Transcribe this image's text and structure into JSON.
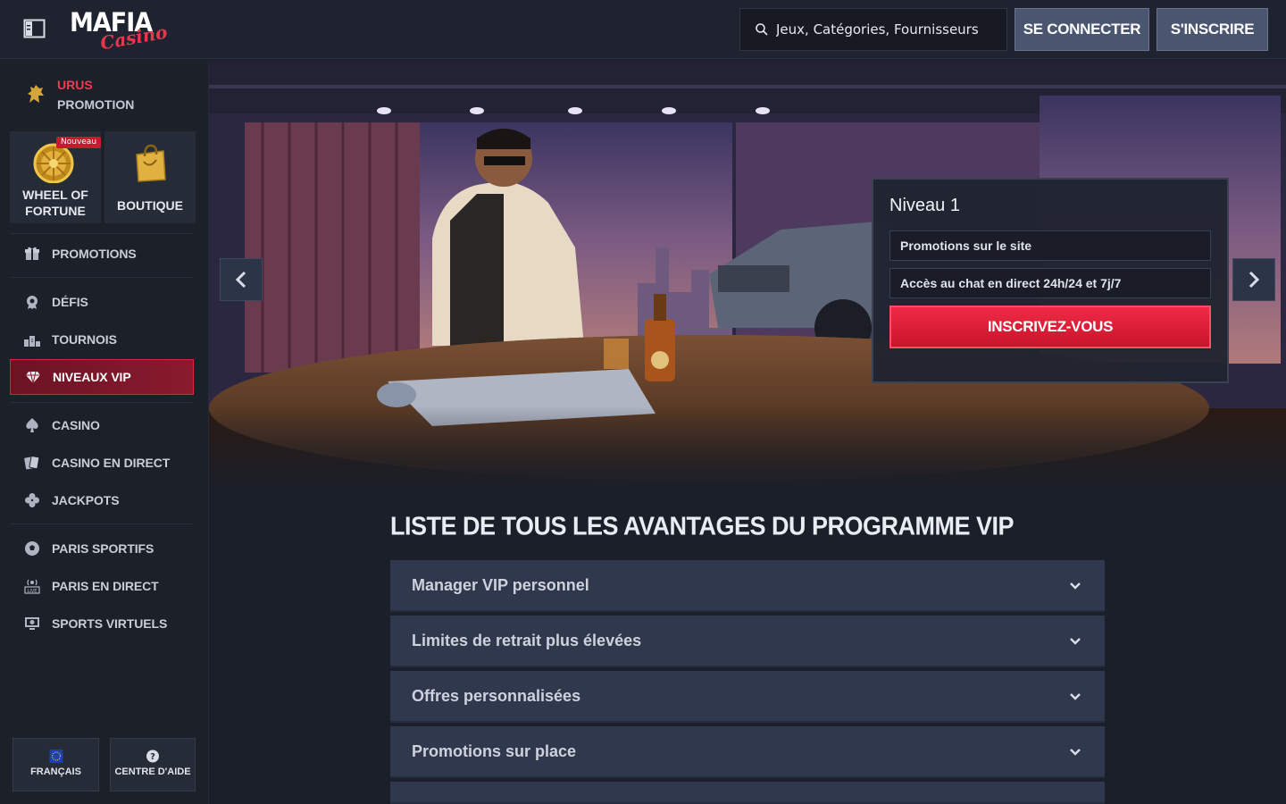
{
  "header": {
    "logo_main": "MAFIA",
    "logo_script": "Casino",
    "search_placeholder": "Jeux, Catégories, Fournisseurs",
    "login_label": "SE CONNECTER",
    "register_label": "S'INSCRIRE"
  },
  "sidebar": {
    "promo": {
      "line1": "URUS",
      "line2": "PROMOTION"
    },
    "tiles": [
      {
        "label_1": "WHEEL OF",
        "label_2": "FORTUNE",
        "badge": "Nouveau"
      },
      {
        "label": "BOUTIQUE"
      }
    ],
    "items": [
      {
        "label": "PROMOTIONS",
        "icon": "gift-icon"
      },
      {
        "label": "DÉFIS",
        "icon": "gear-badge-icon"
      },
      {
        "label": "TOURNOIS",
        "icon": "podium-icon"
      },
      {
        "label": "NIVEAUX VIP",
        "icon": "diamond-icon",
        "active": true
      },
      {
        "label": "CASINO",
        "icon": "spade-icon"
      },
      {
        "label": "CASINO EN DIRECT",
        "icon": "cards-icon"
      },
      {
        "label": "JACKPOTS",
        "icon": "clover-icon"
      },
      {
        "label": "PARIS SPORTIFS",
        "icon": "soccer-ball-icon"
      },
      {
        "label": "PARIS EN DIRECT",
        "icon": "live-icon"
      },
      {
        "label": "SPORTS VIRTUELS",
        "icon": "monitor-icon"
      }
    ],
    "bottom": {
      "language": "FRANÇAIS",
      "help": "CENTRE D'AIDE"
    }
  },
  "hero": {
    "vip_card": {
      "level": "Niveau 1",
      "perks": [
        "Promotions sur le site",
        "Accès au chat en direct 24h/24 et 7j/7"
      ],
      "cta": "INSCRIVEZ-VOUS"
    }
  },
  "main": {
    "title": "LISTE DE TOUS LES AVANTAGES DU PROGRAMME VIP",
    "accordion": [
      "Manager VIP personnel",
      "Limites de retrait plus élevées",
      "Offres personnalisées",
      "Promotions sur place"
    ]
  },
  "colors": {
    "accent_red": "#e0213b",
    "button_slate": "#4a5570",
    "background": "#1b1f2a",
    "panel": "#30384d"
  }
}
